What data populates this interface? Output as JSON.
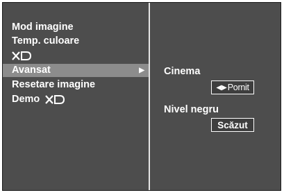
{
  "menu": {
    "items": [
      {
        "label": "Mod imagine"
      },
      {
        "label": "Temp. culoare"
      },
      {
        "label": "XD"
      },
      {
        "label": "Avansat",
        "selected": true
      },
      {
        "label": "Resetare imagine"
      },
      {
        "label": "Demo",
        "logo": "XD"
      }
    ],
    "submenu_arrow_icon": "triangle-right-icon"
  },
  "submenu": {
    "cinema_label": "Cinema",
    "cinema_value": "Pornit",
    "cinema_arrows_icon": "left-right-arrows-icon",
    "black_level_label": "Nivel negru",
    "black_level_value": "Scăzut"
  },
  "colors": {
    "panel": "#4d4d4d",
    "highlight": "#8c8c8c",
    "divider": "#e6e6e6",
    "text": "#ffffff"
  }
}
